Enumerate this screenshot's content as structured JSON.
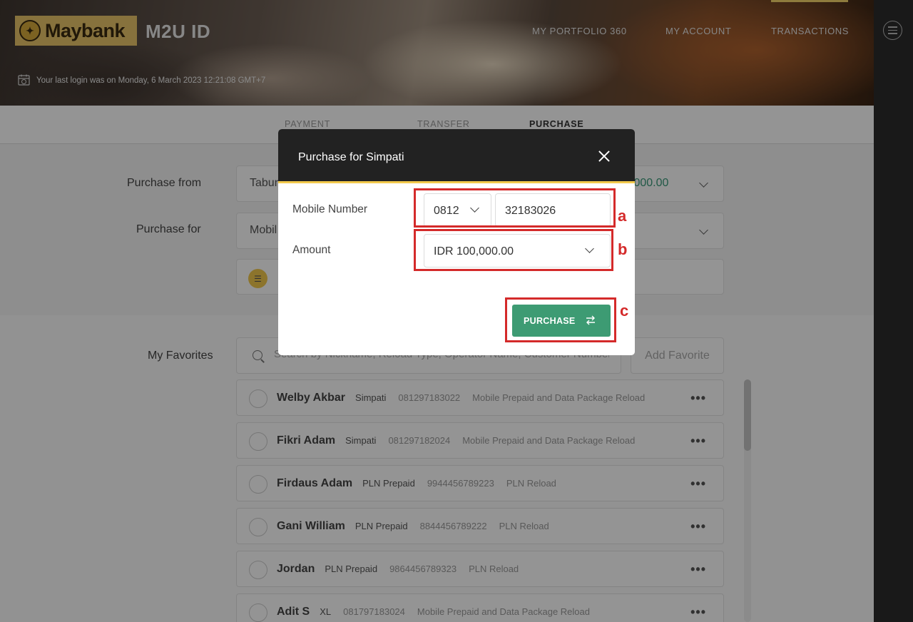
{
  "header": {
    "logo_text": "Maybank",
    "app_name": "M2U ID",
    "nav": [
      "MY PORTFOLIO 360",
      "MY ACCOUNT",
      "TRANSACTIONS"
    ],
    "last_login": "Your last login was on Monday, 6 March 2023 12:21:08 GMT+7"
  },
  "tabs": [
    "PAYMENT",
    "TRANSFER",
    "PURCHASE"
  ],
  "form": {
    "purchase_from_label": "Purchase from",
    "purchase_from_value": "Tabun",
    "purchase_from_amount": ",000.00",
    "purchase_for_label": "Purchase for",
    "purchase_for_value": "Mobil"
  },
  "favorites": {
    "label": "My Favorites",
    "search_placeholder": "Search by Nickname, Reload Type, Operator Name, Customer Number",
    "add_button": "Add Favorite",
    "more_glyph": "•••",
    "items": [
      {
        "name": "Welby Akbar",
        "operator": "Simpati",
        "number": "081297183022",
        "type": "Mobile Prepaid and Data Package Reload"
      },
      {
        "name": "Fikri Adam",
        "operator": "Simpati",
        "number": "081297182024",
        "type": "Mobile Prepaid and Data Package Reload"
      },
      {
        "name": "Firdaus Adam",
        "operator": "PLN Prepaid",
        "number": "9944456789223",
        "type": "PLN Reload"
      },
      {
        "name": "Gani William",
        "operator": "PLN Prepaid",
        "number": "8844456789222",
        "type": "PLN Reload"
      },
      {
        "name": "Jordan",
        "operator": "PLN Prepaid",
        "number": "9864456789323",
        "type": "PLN Reload"
      },
      {
        "name": "Adit S",
        "operator": "XL",
        "number": "081797183024",
        "type": "Mobile Prepaid and Data Package Reload"
      }
    ]
  },
  "modal": {
    "title": "Purchase for Simpati",
    "mobile_label": "Mobile Number",
    "prefix": "0812",
    "number": "32183026",
    "amount_label": "Amount",
    "amount_value": "IDR 100,000.00",
    "purchase_button": "PURCHASE"
  },
  "annotations": [
    "a",
    "b",
    "c"
  ],
  "colors": {
    "brand_yellow": "#e8c46a",
    "accent_green": "#3d9b73",
    "annotation_red": "#d42a2a",
    "modal_header": "#222222"
  }
}
